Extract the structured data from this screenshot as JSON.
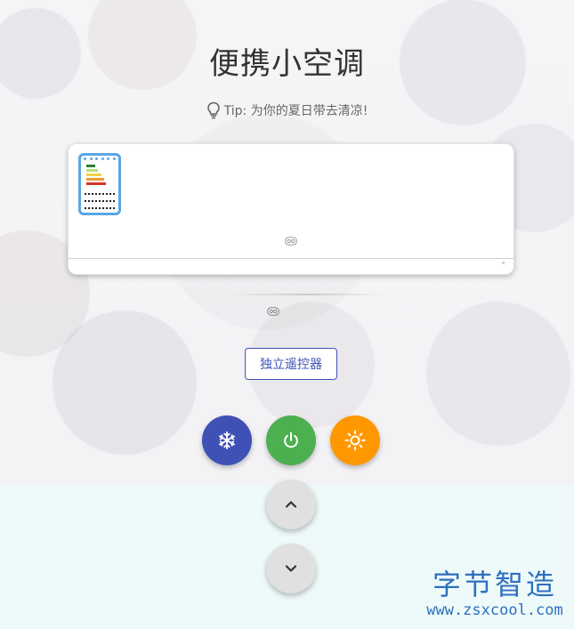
{
  "app": {
    "title": "便携小空调",
    "tip": "Tip: 为你的夏日带去清凉!"
  },
  "icons": {
    "tip": "lightbulb-icon",
    "cool": "snowflake-icon",
    "power": "power-icon",
    "heat": "sun-icon",
    "up": "chevron-up-icon",
    "down": "chevron-down-icon"
  },
  "controls": {
    "remote_button_label": "独立遥控器"
  },
  "colors": {
    "cool": "#3f51b5",
    "power": "#4caf50",
    "heat": "#ff9800",
    "adjust": "#e0e0e0",
    "screen_border": "#5aa6e6"
  },
  "watermark": {
    "name": "字节智造",
    "url": "www.zsxcool.com"
  }
}
